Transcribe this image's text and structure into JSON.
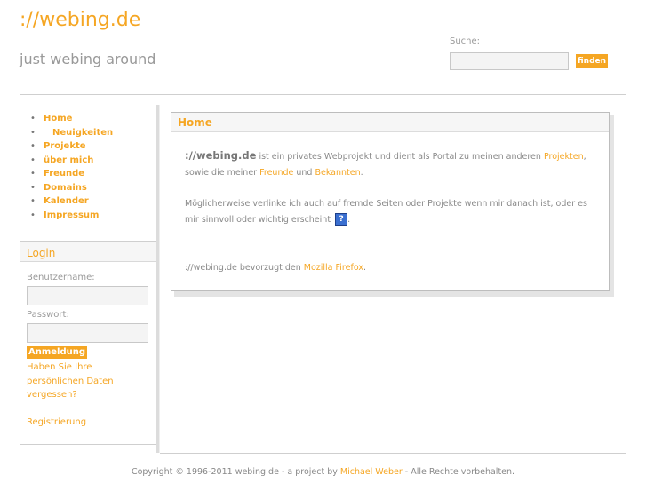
{
  "header": {
    "site_title": "://webing.de",
    "tagline": "just webing around",
    "search_label": "Suche:",
    "search_placeholder": "",
    "search_button": "finden"
  },
  "nav": {
    "items": [
      {
        "label": "Home"
      },
      {
        "label": "Neuigkeiten"
      },
      {
        "label": "Projekte"
      },
      {
        "label": "über mich"
      },
      {
        "label": "Freunde"
      },
      {
        "label": "Domains"
      },
      {
        "label": "Kalender"
      },
      {
        "label": "Impressum"
      }
    ]
  },
  "login": {
    "title": "Login",
    "username_label": "Benutzername:",
    "username_value": "",
    "password_label": "Passwort:",
    "password_value": "",
    "submit_label": "Anmeldung",
    "forgot_label": "Haben Sie Ihre persönlichen Daten vergessen?",
    "register_label": "Registrierung"
  },
  "content": {
    "title": "Home",
    "p1_brand": "://webing.de",
    "p1_text1": " ist ein privates Webprojekt und dient als Portal zu meinen anderen ",
    "p1_link1": "Projekten",
    "p1_text2": ", sowie die meiner ",
    "p1_link2": "Freunde",
    "p1_text3": " und ",
    "p1_link3": "Bekannten",
    "p1_text4": ".",
    "p2_text": "Möglicherweise verlinke ich auch auf fremde Seiten oder Projekte wenn mir danach ist, oder es mir sinnvoll oder wichtig erscheint",
    "p2_icon": "?",
    "p2_end": ".",
    "p3_text": "://webing.de bevorzugt den ",
    "p3_link": "Mozilla Firefox",
    "p3_end": "."
  },
  "footer": {
    "text1": "Copyright © 1996-2011 webing.de - a project by ",
    "link": "Michael Weber",
    "text2": " - Alle Rechte vorbehalten."
  },
  "colors": {
    "accent": "#f5a623",
    "text": "#888888",
    "rule": "#cfcfcf"
  }
}
